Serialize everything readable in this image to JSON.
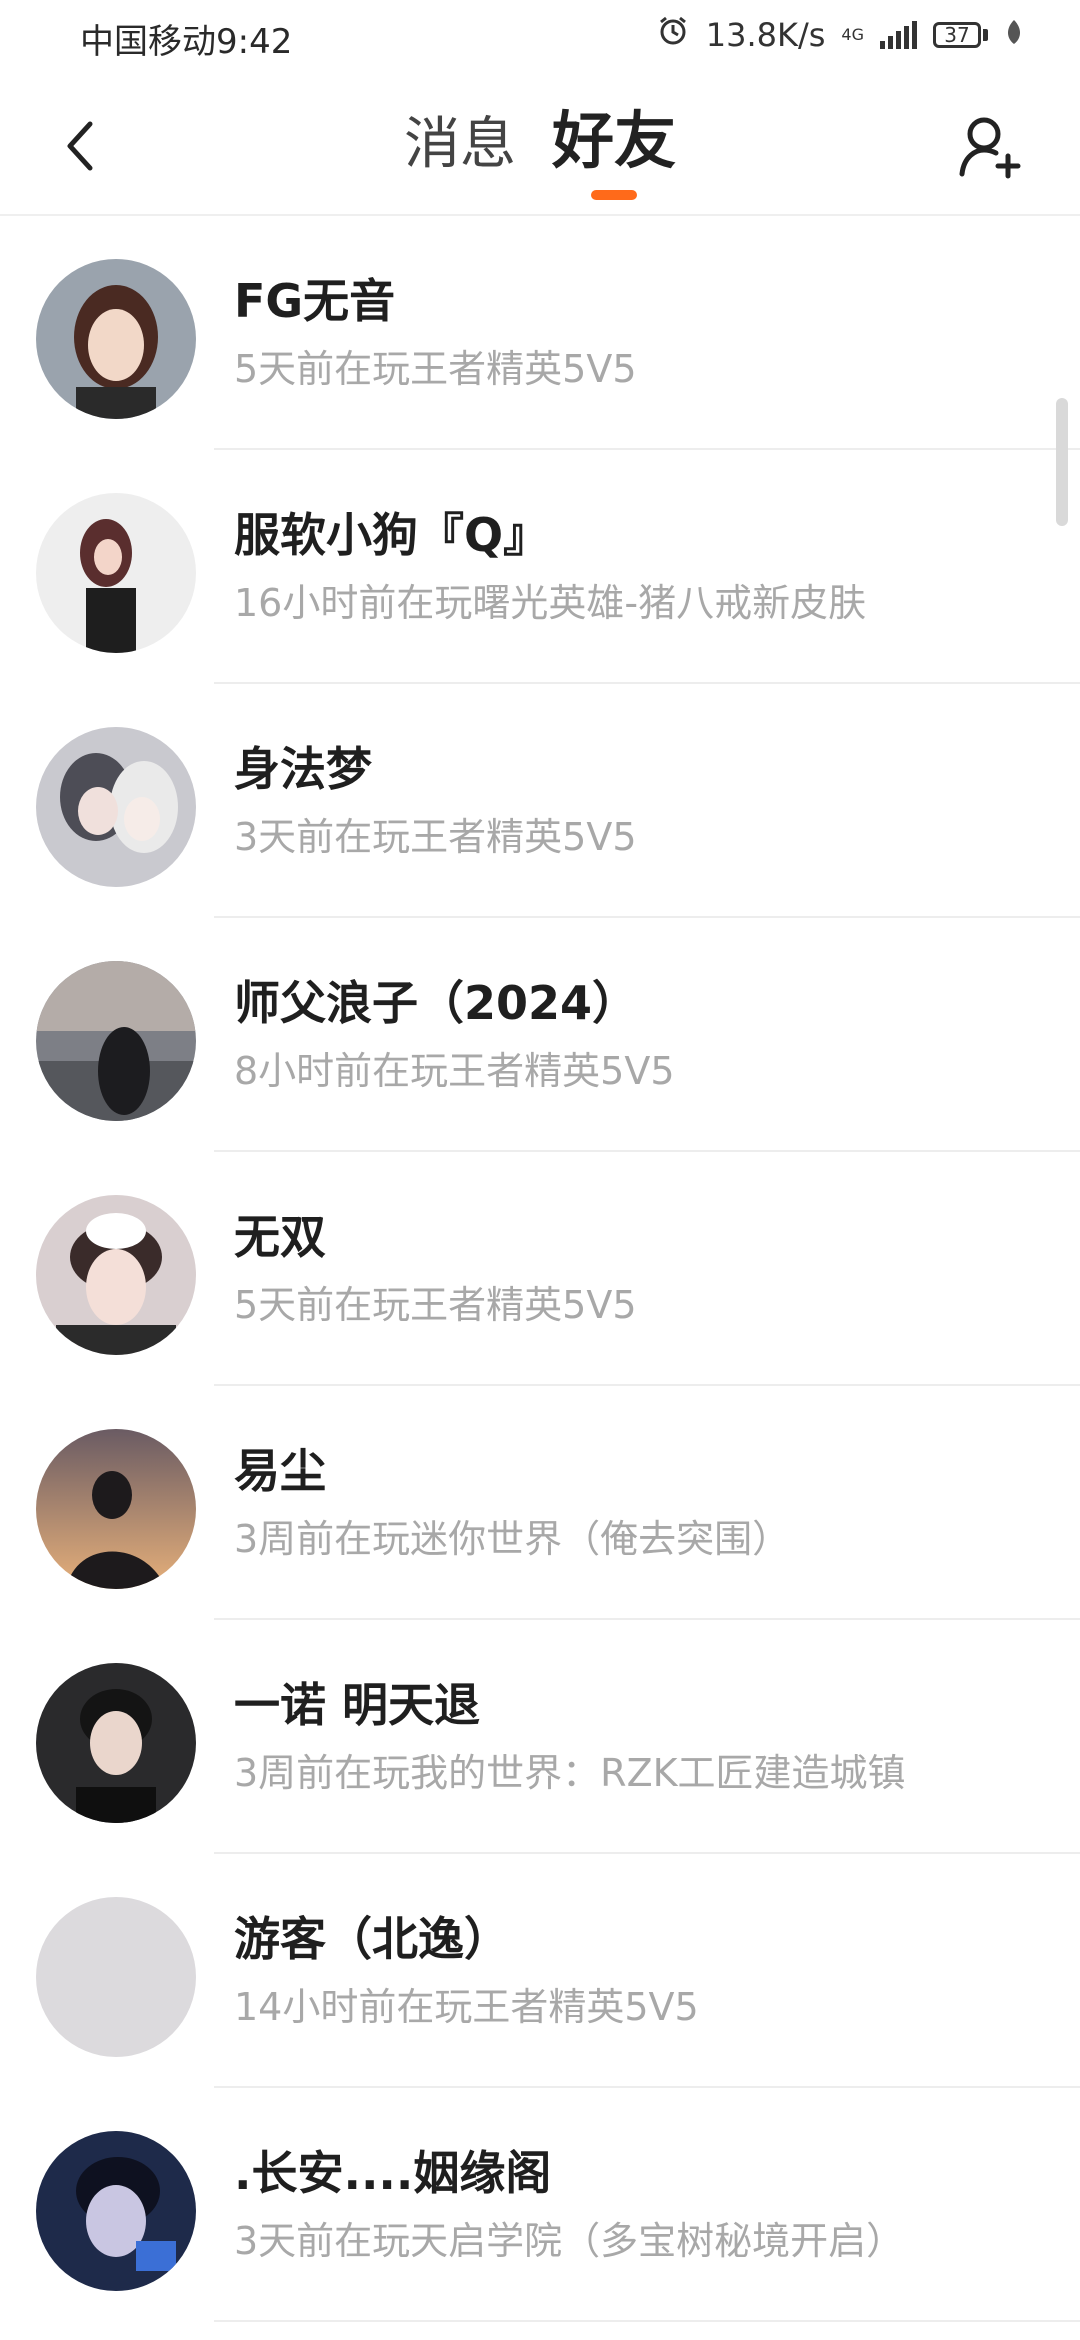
{
  "status_bar": {
    "carrier_time": "中国移动9:42",
    "speed": "13.8K/s",
    "network": "4G",
    "battery": "37"
  },
  "header": {
    "tabs": [
      {
        "label": "消息",
        "active": false
      },
      {
        "label": "好友",
        "active": true
      }
    ],
    "accent_color": "#ff6a1a"
  },
  "friends": [
    {
      "name": "FG无音",
      "status": "5天前在玩王者精英5V5"
    },
    {
      "name": "服软小狗『Q』",
      "status": "16小时前在玩曙光英雄-猪八戒新皮肤"
    },
    {
      "name": "身法梦",
      "status": "3天前在玩王者精英5V5"
    },
    {
      "name": "师父浪子（2024）",
      "status": "8小时前在玩王者精英5V5"
    },
    {
      "name": "无双",
      "status": "5天前在玩王者精英5V5"
    },
    {
      "name": "易尘",
      "status": "3周前在玩迷你世界（俺去突围）"
    },
    {
      "name": "一诺 明天退",
      "status": "3周前在玩我的世界：RZK工匠建造城镇"
    },
    {
      "name": "游客（北逸）",
      "status": "14小时前在玩王者精英5V5"
    },
    {
      "name": ".长安....姻缘阁",
      "status": "3天前在玩天启学院（多宝树秘境开启）"
    }
  ]
}
